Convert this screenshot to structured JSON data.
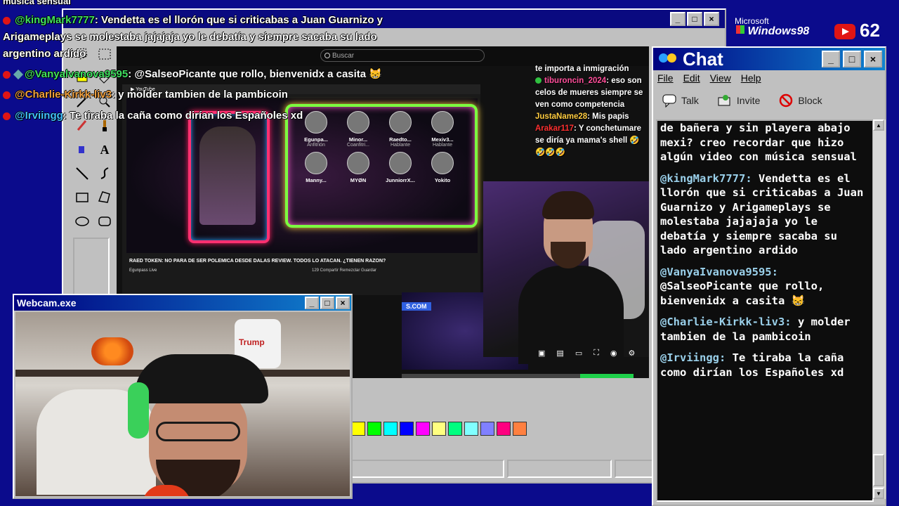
{
  "overlay": {
    "top_partial": "música sensual",
    "lines": [
      {
        "user": "@kingMark7777",
        "text": ": Vendetta es el llorón que si criticabas a Juan Guarnizo y"
      },
      {
        "user": "",
        "text": "Arigameplays se molestaba jajajaja yo le debatía y siempre sacaba su lado"
      },
      {
        "user": "",
        "text": "argentino ardido"
      },
      {
        "user": "@Vanyalvanova9595",
        "text": ": @SalseoPicante que rollo, bienvenidx a casita 😸"
      },
      {
        "user": "@Charlie-Kirkk-liv3",
        "text": ": y molder tambien de la pambicoin"
      },
      {
        "user": "@Irviingg",
        "text": ": Te tiraba la caña como dirían los Españoles xd"
      }
    ]
  },
  "branding": {
    "microsoft": "Microsoft",
    "windows": "Windows98",
    "viewers": "62"
  },
  "paint": {
    "palette": [
      "#ffff00",
      "#00ff00",
      "#00ffff",
      "#0000ff",
      "#ff00ff",
      "#ffff80",
      "#00ff80",
      "#80ffff",
      "#8080ff",
      "#ff0080",
      "#ff8040"
    ],
    "screenshot": {
      "search_placeholder": "Buscar",
      "guests": [
        {
          "name": "Egunpa...",
          "role": "Anfitrión"
        },
        {
          "name": "Minor...",
          "role": "Coanfitri..."
        },
        {
          "name": "Raedto...",
          "role": "Hablante"
        },
        {
          "name": "Mexiv3...",
          "role": "Hablante"
        },
        {
          "name": "Manny...",
          "role": ""
        },
        {
          "name": "MYØN",
          "role": ""
        },
        {
          "name": "JunniorrX...",
          "role": ""
        },
        {
          "name": "Yokito",
          "role": ""
        }
      ],
      "video_title": "RAED TOKEN: NO PARA DE SER POLEMICA DESDE DALAS REVIEW. TODOS LO ATACAN. ¿TIENEN RAZON?",
      "channel": "Egunpass Live",
      "actions": "129   Compartir   Remezclar   Guardar",
      "stars_tag": "S.COM",
      "chat": [
        {
          "user": "",
          "text": "te importa a inmigración"
        },
        {
          "user": "tiburoncin_2024",
          "text": ": eso son celos de mueres siempre se ven como competencia"
        },
        {
          "user": "JustaName28",
          "text": ": Mis papis"
        },
        {
          "user": "Arakar117",
          "text": ": Y conchetumare se diría ya mama's shell 🤣🤣🤣🤣"
        }
      ]
    }
  },
  "webcam": {
    "title": "Webcam.exe",
    "minimize": "_",
    "maximize": "□",
    "close": "×",
    "toilet_label": "Trump"
  },
  "chat": {
    "title": "Chat",
    "menu": [
      "File",
      "Edit",
      "View",
      "Help"
    ],
    "tools": [
      "Talk",
      "Invite",
      "Block"
    ],
    "messages": [
      {
        "user": "",
        "text": "de bañera y sin playera abajo mexi? creo recordar que hizo algún video con música sensual"
      },
      {
        "user": "@kingMark7777:",
        "text": "Vendetta es el llorón que si criticabas a Juan Guarnizo y Arigameplays se molestaba jajajaja yo le debatía y siempre sacaba su lado argentino ardido"
      },
      {
        "user": "@VanyaIvanova9595:",
        "text": "@SalseoPicante que rollo, bienvenidx a casita 😸"
      },
      {
        "user": "@Charlie-Kirkk-liv3:",
        "text": "y molder tambien de la pambicoin"
      },
      {
        "user": "@Irviingg:",
        "text": "Te tiraba la caña como dirían los Españoles xd"
      }
    ]
  }
}
